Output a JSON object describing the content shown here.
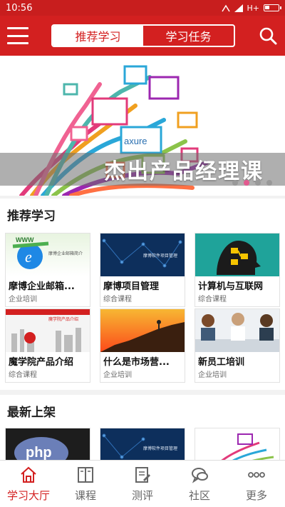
{
  "status_bar": {
    "time": "10:56",
    "network": "H+"
  },
  "header": {
    "tabs": [
      {
        "label": "推荐学习",
        "active": true
      },
      {
        "label": "学习任务",
        "active": false
      }
    ],
    "accent_color": "#d32020"
  },
  "banner": {
    "caption": "杰出产品经理课",
    "image_brand": "axure",
    "slide_count": 5,
    "active_slide": 2
  },
  "recommended": {
    "heading": "推荐学习",
    "items": [
      {
        "title": "摩博企业邮箱...",
        "category": "企业培训",
        "thumb_text": "摩博企业邮箱简介",
        "thumb_logo": "WWW"
      },
      {
        "title": "摩博项目管理",
        "category": "综合课程",
        "thumb_text": "摩博软件项目管理"
      },
      {
        "title": "计算机与互联网",
        "category": "综合课程"
      },
      {
        "title": "魔学院产品介绍",
        "category": "综合课程",
        "thumb_text": "魔学院产品介绍"
      },
      {
        "title": "什么是市场营...",
        "category": "企业培训"
      },
      {
        "title": "新员工培训",
        "category": "企业培训"
      }
    ]
  },
  "newest": {
    "heading": "最新上架",
    "items": [
      {
        "thumb_text": "php"
      },
      {
        "thumb_text": "摩博软件项目管理"
      },
      {
        "thumb_text": ""
      }
    ]
  },
  "tabbar": [
    {
      "label": "学习大厅",
      "icon": "home-icon",
      "active": true
    },
    {
      "label": "课程",
      "icon": "book-icon",
      "active": false
    },
    {
      "label": "测评",
      "icon": "edit-icon",
      "active": false
    },
    {
      "label": "社区",
      "icon": "chat-icon",
      "active": false
    },
    {
      "label": "更多",
      "icon": "more-icon",
      "active": false
    }
  ]
}
